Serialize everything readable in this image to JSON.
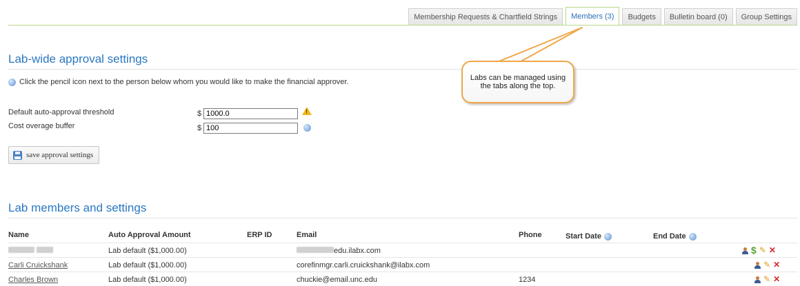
{
  "tabs": [
    {
      "label": "Membership Requests & Chartfield Strings",
      "active": false
    },
    {
      "label": "Members (3)",
      "active": true
    },
    {
      "label": "Budgets",
      "active": false
    },
    {
      "label": "Bulletin board (0)",
      "active": false
    },
    {
      "label": "Group Settings",
      "active": false
    }
  ],
  "approval": {
    "heading": "Lab-wide approval settings",
    "hint": "Click the pencil icon next to the person below whom you would like to make the financial approver.",
    "threshold_label": "Default auto-approval threshold",
    "threshold_currency": "$",
    "threshold_value": "1000.0",
    "buffer_label": "Cost overage buffer",
    "buffer_currency": "$",
    "buffer_value": "100",
    "save_label": "save approval settings"
  },
  "callout": {
    "text": "Labs can be managed using the tabs along the top."
  },
  "members": {
    "heading": "Lab members and settings",
    "columns": {
      "name": "Name",
      "auto_approval": "Auto Approval Amount",
      "erp_id": "ERP ID",
      "email": "Email",
      "phone": "Phone",
      "start_date": "Start Date",
      "end_date": "End Date"
    },
    "rows": [
      {
        "name": "",
        "auto_approval": "Lab default ($1,000.00)",
        "email": "edu.ilabx.com",
        "phone": "",
        "actions": [
          "user-icon",
          "dollar-icon",
          "pencil-icon",
          "delete-icon"
        ]
      },
      {
        "name": "Carli Cruickshank",
        "auto_approval": "Lab default ($1,000.00)",
        "email": "corefinmgr.carli.cruickshank@ilabx.com",
        "phone": "",
        "actions": [
          "user-icon",
          "pencil-icon",
          "delete-icon"
        ]
      },
      {
        "name": "Charles Brown",
        "auto_approval": "Lab default ($1,000.00)",
        "email": "chuckie@email.unc.edu",
        "phone": "1234",
        "actions": [
          "user-icon",
          "pencil-icon",
          "delete-icon"
        ]
      }
    ]
  },
  "colors": {
    "accent": "#2a78c2",
    "tab_border": "#b8d78a",
    "callout_border": "#f0a64a"
  }
}
